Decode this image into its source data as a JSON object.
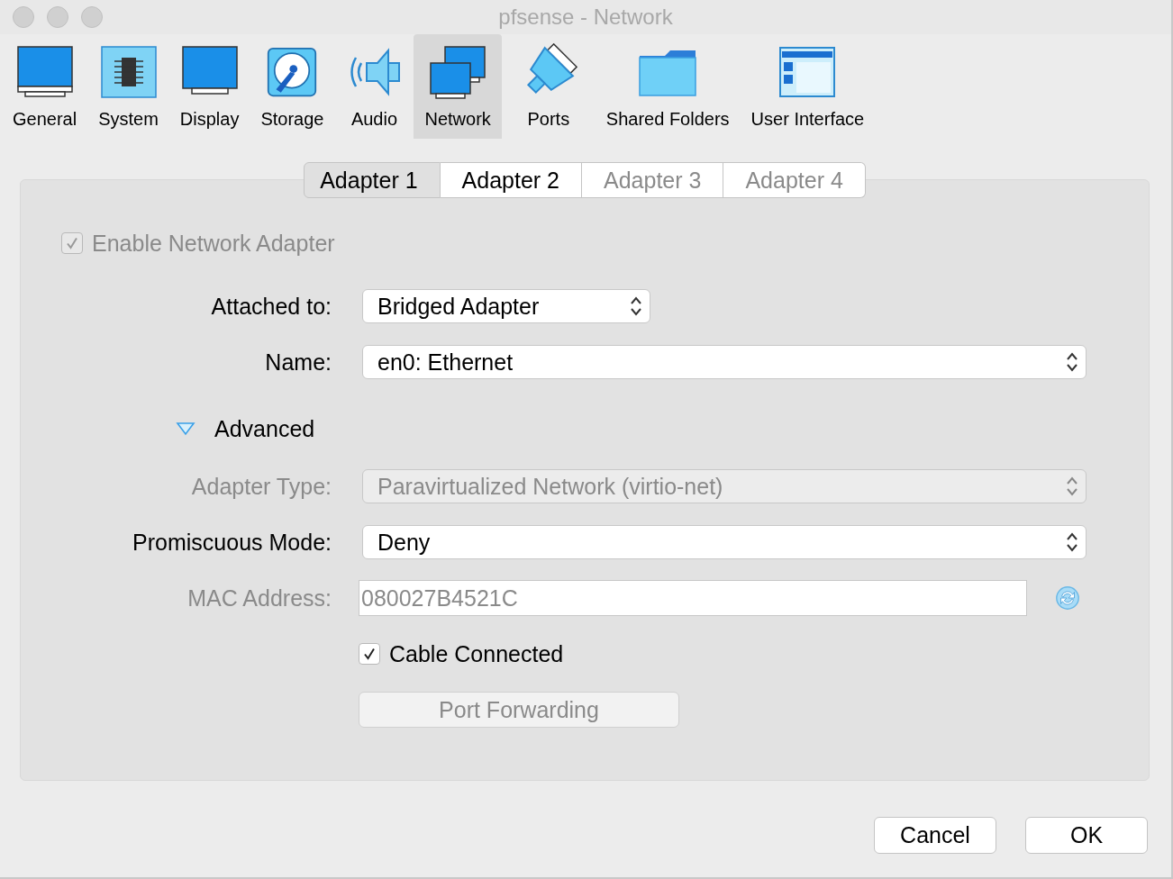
{
  "window": {
    "title": "pfsense - Network"
  },
  "toolbar": [
    {
      "label": "General",
      "selected": false
    },
    {
      "label": "System",
      "selected": false
    },
    {
      "label": "Display",
      "selected": false
    },
    {
      "label": "Storage",
      "selected": false
    },
    {
      "label": "Audio",
      "selected": false
    },
    {
      "label": "Network",
      "selected": true
    },
    {
      "label": "Ports",
      "selected": false
    },
    {
      "label": "Shared Folders",
      "selected": false
    },
    {
      "label": "User Interface",
      "selected": false
    }
  ],
  "adapter_tabs": [
    {
      "label": "Adapter 1",
      "selected": true,
      "disabled": false
    },
    {
      "label": "Adapter 2",
      "selected": false,
      "disabled": false
    },
    {
      "label": "Adapter 3",
      "selected": false,
      "disabled": true
    },
    {
      "label": "Adapter 4",
      "selected": false,
      "disabled": true
    }
  ],
  "enable_adapter": {
    "label": "Enable Network Adapter",
    "checked": true,
    "disabled": true
  },
  "fields": [
    {
      "kind": "compact-select",
      "label": "Attached to:",
      "value": "Bridged Adapter",
      "disabled": false
    },
    {
      "kind": "select",
      "label": "Name:",
      "value": "en0: Ethernet",
      "disabled": false
    }
  ],
  "advanced": {
    "label": "Advanced",
    "expanded": true,
    "fields": [
      {
        "kind": "select",
        "label": "Adapter Type:",
        "value": "Paravirtualized Network (virtio-net)",
        "disabled": true
      },
      {
        "kind": "select",
        "label": "Promiscuous Mode:",
        "value": "Deny",
        "disabled": false
      },
      {
        "kind": "text",
        "label": "MAC Address:",
        "value": "080027B4521C",
        "disabled": true
      }
    ],
    "cable_connected": {
      "label": "Cable Connected",
      "checked": true
    },
    "port_forwarding": {
      "label": "Port Forwarding",
      "disabled": true
    }
  },
  "buttons": [
    {
      "label": "Cancel"
    },
    {
      "label": "OK"
    }
  ]
}
